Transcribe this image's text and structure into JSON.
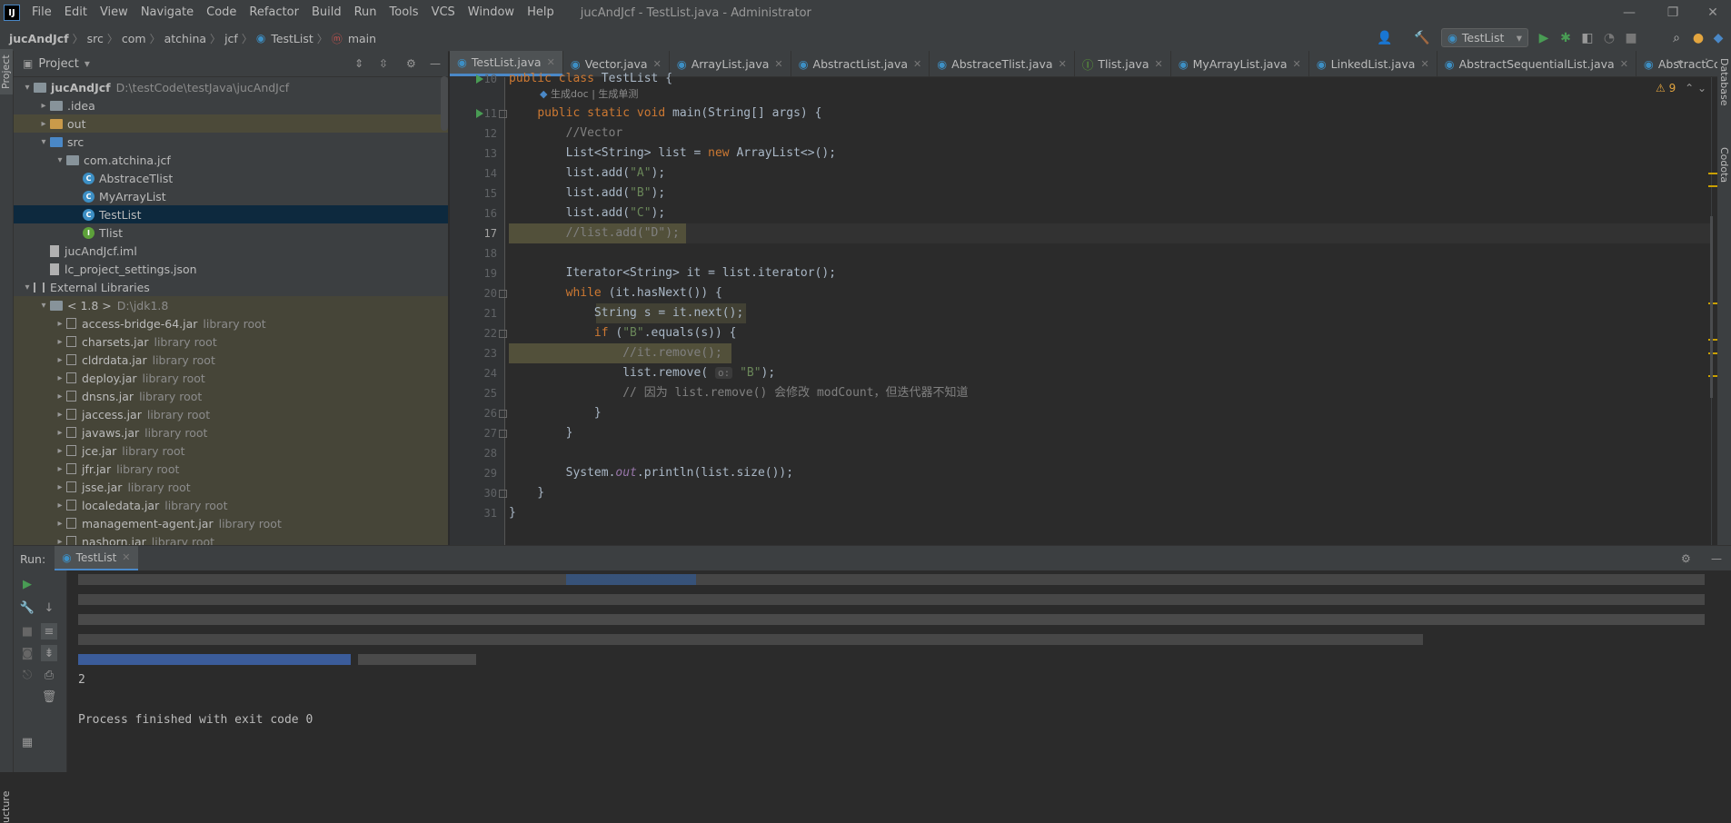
{
  "app": {
    "window_title": "jucAndJcf - TestList.java - Administrator",
    "menu": [
      "File",
      "Edit",
      "View",
      "Navigate",
      "Code",
      "Refactor",
      "Build",
      "Run",
      "Tools",
      "VCS",
      "Window",
      "Help"
    ]
  },
  "breadcrumb": [
    "jucAndJcf",
    "src",
    "com",
    "atchina",
    "jcf",
    "TestList",
    "main"
  ],
  "toolbar": {
    "run_config": "TestList"
  },
  "project": {
    "title": "Project",
    "strip_label": "Project",
    "tree": [
      {
        "name": "jucAndJcf",
        "extra": "D:\\testCode\\testJava\\jucAndJcf",
        "indent": 0,
        "arrow": "▾",
        "icon": "folder",
        "bold": true
      },
      {
        "name": ".idea",
        "extra": "",
        "indent": 1,
        "arrow": "▸",
        "icon": "folder"
      },
      {
        "name": "out",
        "extra": "",
        "indent": 1,
        "arrow": "▸",
        "icon": "folder-orange",
        "style": "excluded"
      },
      {
        "name": "src",
        "extra": "",
        "indent": 1,
        "arrow": "▾",
        "icon": "folder-blue"
      },
      {
        "name": "com.atchina.jcf",
        "extra": "",
        "indent": 2,
        "arrow": "▾",
        "icon": "folder"
      },
      {
        "name": "AbstraceTlist",
        "extra": "",
        "indent": 3,
        "arrow": "",
        "icon": "class"
      },
      {
        "name": "MyArrayList",
        "extra": "",
        "indent": 3,
        "arrow": "",
        "icon": "class"
      },
      {
        "name": "TestList",
        "extra": "",
        "indent": 3,
        "arrow": "",
        "icon": "class",
        "style": "selected"
      },
      {
        "name": "Tlist",
        "extra": "",
        "indent": 3,
        "arrow": "",
        "icon": "iface"
      },
      {
        "name": "jucAndJcf.iml",
        "extra": "",
        "indent": 1,
        "arrow": "",
        "icon": "file"
      },
      {
        "name": "lc_project_settings.json",
        "extra": "",
        "indent": 1,
        "arrow": "",
        "icon": "file"
      },
      {
        "name": "External Libraries",
        "extra": "",
        "indent": 0,
        "arrow": "▾",
        "icon": "lib"
      },
      {
        "name": "< 1.8 >",
        "extra": "D:\\jdk1.8",
        "indent": 1,
        "arrow": "▾",
        "icon": "folder",
        "style": "libzone"
      },
      {
        "name": "access-bridge-64.jar",
        "extra": "library root",
        "indent": 2,
        "arrow": "▸",
        "icon": "jar",
        "style": "libzone"
      },
      {
        "name": "charsets.jar",
        "extra": "library root",
        "indent": 2,
        "arrow": "▸",
        "icon": "jar",
        "style": "libzone"
      },
      {
        "name": "cldrdata.jar",
        "extra": "library root",
        "indent": 2,
        "arrow": "▸",
        "icon": "jar",
        "style": "libzone"
      },
      {
        "name": "deploy.jar",
        "extra": "library root",
        "indent": 2,
        "arrow": "▸",
        "icon": "jar",
        "style": "libzone"
      },
      {
        "name": "dnsns.jar",
        "extra": "library root",
        "indent": 2,
        "arrow": "▸",
        "icon": "jar",
        "style": "libzone"
      },
      {
        "name": "jaccess.jar",
        "extra": "library root",
        "indent": 2,
        "arrow": "▸",
        "icon": "jar",
        "style": "libzone"
      },
      {
        "name": "javaws.jar",
        "extra": "library root",
        "indent": 2,
        "arrow": "▸",
        "icon": "jar",
        "style": "libzone"
      },
      {
        "name": "jce.jar",
        "extra": "library root",
        "indent": 2,
        "arrow": "▸",
        "icon": "jar",
        "style": "libzone"
      },
      {
        "name": "jfr.jar",
        "extra": "library root",
        "indent": 2,
        "arrow": "▸",
        "icon": "jar",
        "style": "libzone"
      },
      {
        "name": "jsse.jar",
        "extra": "library root",
        "indent": 2,
        "arrow": "▸",
        "icon": "jar",
        "style": "libzone"
      },
      {
        "name": "localedata.jar",
        "extra": "library root",
        "indent": 2,
        "arrow": "▸",
        "icon": "jar",
        "style": "libzone"
      },
      {
        "name": "management-agent.jar",
        "extra": "library root",
        "indent": 2,
        "arrow": "▸",
        "icon": "jar",
        "style": "libzone"
      },
      {
        "name": "nashorn.jar",
        "extra": "library root",
        "indent": 2,
        "arrow": "▸",
        "icon": "jar",
        "style": "libzone"
      }
    ]
  },
  "tabs": [
    {
      "label": "TestList.java",
      "active": true
    },
    {
      "label": "Vector.java"
    },
    {
      "label": "ArrayList.java"
    },
    {
      "label": "AbstractList.java"
    },
    {
      "label": "AbstraceTlist.java"
    },
    {
      "label": "Tlist.java"
    },
    {
      "label": "MyArrayList.java"
    },
    {
      "label": "LinkedList.java"
    },
    {
      "label": "AbstractSequentialList.java"
    },
    {
      "label": "AbstractColle"
    }
  ],
  "editor": {
    "inlay_hint": "生成doc | 生成单测",
    "warning_count": "9",
    "current_line": "17",
    "lines": [
      {
        "n": "10",
        "html": "<span class='kw'>public class</span> TestList {"
      },
      {
        "n": "11",
        "html": "    <span class='kw'>public static void</span> main(String[] args) {"
      },
      {
        "n": "12",
        "html": "        <span class='cm'>//Vector</span>"
      },
      {
        "n": "13",
        "html": "        List&lt;String&gt; list = <span class='kw'>new</span> ArrayList&lt;&gt;();"
      },
      {
        "n": "14",
        "html": "        list.add(<span class='str'>\"A\"</span>);"
      },
      {
        "n": "15",
        "html": "        list.add(<span class='str'>\"B\"</span>);"
      },
      {
        "n": "16",
        "html": "        list.add(<span class='str'>\"C\"</span>);"
      },
      {
        "n": "17",
        "html": "        <span class='cm'>//list.add(\"D\");</span>"
      },
      {
        "n": "18",
        "html": ""
      },
      {
        "n": "19",
        "html": "        Iterator&lt;String&gt; it = list.iterator();"
      },
      {
        "n": "20",
        "html": "        <span class='kw'>while</span> (it.hasNext()) {"
      },
      {
        "n": "21",
        "html": "            String s = it.next();"
      },
      {
        "n": "22",
        "html": "            <span class='kw'>if</span> (<span class='str'>\"B\"</span>.equals(s)) {"
      },
      {
        "n": "23",
        "html": "                <span class='cm'>//it.remove();</span>"
      },
      {
        "n": "24",
        "html": "                list.remove( <span class='hint'>o:</span> <span class='str'>\"B\"</span>);"
      },
      {
        "n": "25",
        "html": "                <span class='cm'>// 因为 list.remove() 会修改 modCount，但迭代器不知道</span>"
      },
      {
        "n": "26",
        "html": "            }"
      },
      {
        "n": "27",
        "html": "        }"
      },
      {
        "n": "28",
        "html": ""
      },
      {
        "n": "29",
        "html": "        System.<span class='fld'>out</span>.println(list.size());"
      },
      {
        "n": "30",
        "html": "    }"
      },
      {
        "n": "31",
        "html": "}"
      }
    ]
  },
  "run": {
    "label": "Run:",
    "tab": "TestList",
    "output_size": "2",
    "exit_message": "Process finished with exit code 0"
  },
  "right_strip": [
    "Database",
    "Codota"
  ],
  "bottom_strip_label": "ucture"
}
